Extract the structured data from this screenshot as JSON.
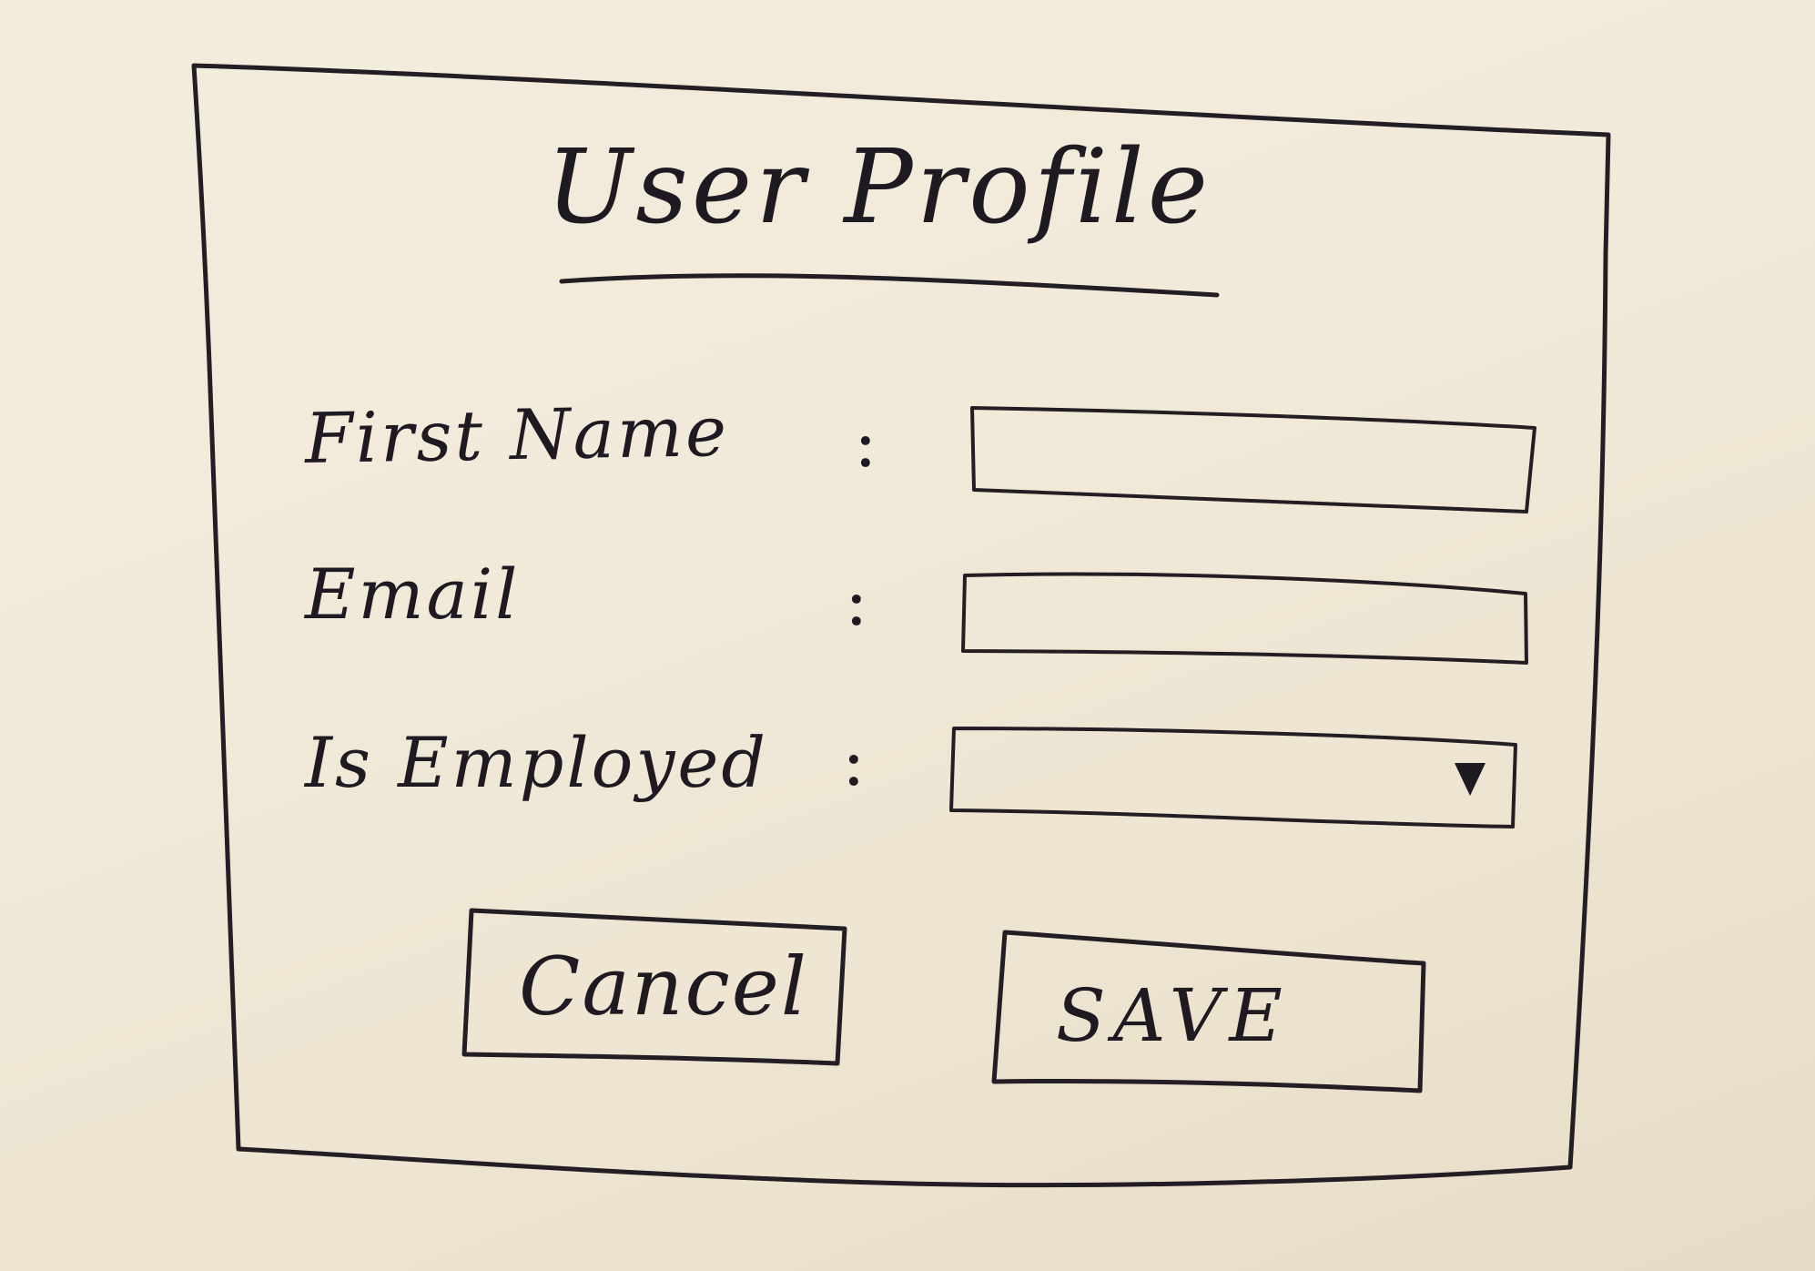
{
  "dialog": {
    "title": "User Profile"
  },
  "form": {
    "first_name": {
      "label": "First Name",
      "separator": ":",
      "value": ""
    },
    "email": {
      "label": "Email",
      "separator": ":",
      "value": ""
    },
    "is_employed": {
      "label": "Is Employed",
      "separator": ":",
      "selected": ""
    }
  },
  "actions": {
    "cancel_label": "Cancel",
    "save_label": "SAVE"
  },
  "icons": {
    "dropdown": "chevron-down-icon"
  }
}
